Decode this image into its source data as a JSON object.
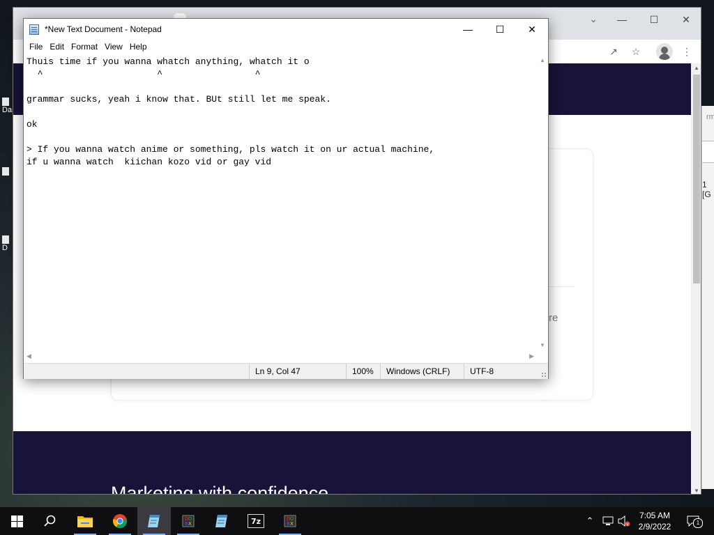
{
  "desktop": {
    "icon_labels": [
      "Da",
      "D"
    ]
  },
  "browser": {
    "page_fragment": "re",
    "footer_heading": "Marketing with confidence",
    "side_peek_top": "rma",
    "side_peek_label": "1 [G"
  },
  "notepad": {
    "title": "*New Text Document - Notepad",
    "menu": [
      "File",
      "Edit",
      "Format",
      "View",
      "Help"
    ],
    "content": "Thuis time if you wanna whatch anything, whatch it o\n  ^                     ^                 ^\n\ngrammar sucks, yeah i know that. BUt still let me speak.\n\nok\n\n> If you wanna watch anime or something, pls watch it on ur actual machine,\nif u wanna watch  kiichan kozo vid or gay vid",
    "status": {
      "position": "Ln 9, Col 47",
      "zoom": "100%",
      "line_ending": "Windows (CRLF)",
      "encoding": "UTF-8"
    }
  },
  "taskbar": {
    "apps": [
      {
        "icon": "start-icon"
      },
      {
        "icon": "search-icon"
      },
      {
        "icon": "file-explorer-icon"
      },
      {
        "icon": "chrome-icon"
      },
      {
        "icon": "notepad-icon"
      },
      {
        "icon": "dosbox-icon"
      },
      {
        "icon": "notepad-icon"
      },
      {
        "icon": "7zip-icon",
        "label": "7z"
      },
      {
        "icon": "dosbox-icon"
      }
    ],
    "clock": {
      "time": "7:05 AM",
      "date": "2/9/2022"
    },
    "notification_count": "1"
  },
  "colors": {
    "accent": "#7cb7f5",
    "page_navy": "#171339",
    "taskbar": "#0f0f12"
  }
}
